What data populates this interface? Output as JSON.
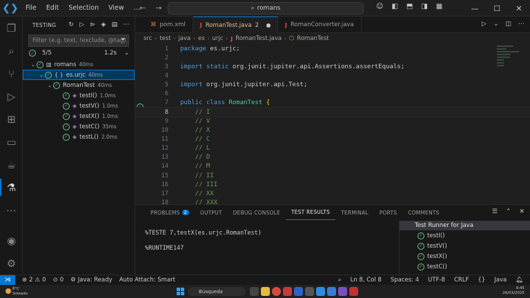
{
  "titlebar": {
    "menu": [
      "File",
      "Edit",
      "Selection",
      "View"
    ],
    "more": "…",
    "search_text": "romans"
  },
  "sidebar": {
    "title": "TESTING",
    "filter_placeholder": "Filter (e.g. text, !exclude, @tag)",
    "summary": "5/5",
    "summary_time": "1.2s",
    "tree": [
      {
        "label": "romans",
        "duration": "40ms",
        "kind": "module",
        "level": 0
      },
      {
        "label": "es.urjc",
        "duration": "40ms",
        "kind": "package",
        "level": 1
      },
      {
        "label": "RomanTest",
        "duration": "40ms",
        "kind": "class",
        "level": 2
      },
      {
        "label": "testI()",
        "duration": "1.0ms",
        "kind": "method",
        "level": 3
      },
      {
        "label": "testV()",
        "duration": "1.0ms",
        "kind": "method",
        "level": 3
      },
      {
        "label": "testX()",
        "duration": "1.0ms",
        "kind": "method",
        "level": 3
      },
      {
        "label": "testC()",
        "duration": "35ms",
        "kind": "method",
        "level": 3
      },
      {
        "label": "testL()",
        "duration": "2.0ms",
        "kind": "method",
        "level": 3
      }
    ]
  },
  "editor": {
    "tabs": [
      {
        "label": "pom.xml",
        "badge": ""
      },
      {
        "label": "RomanTest.java",
        "badge": "2"
      },
      {
        "label": "RomanConverter.java",
        "badge": ""
      }
    ],
    "breadcrumb": [
      "src",
      "test",
      "java",
      "es",
      "urjc",
      "RomanTest.java",
      "RomanTest"
    ],
    "lines": [
      {
        "n": "1",
        "text": "package es.urjc;"
      },
      {
        "n": "2",
        "text": ""
      },
      {
        "n": "3",
        "text": "import static org.junit.jupiter.api.Assertions.assertEquals;"
      },
      {
        "n": "4",
        "text": ""
      },
      {
        "n": "5",
        "text": "import org.junit.jupiter.api.Test;"
      },
      {
        "n": "6",
        "text": ""
      },
      {
        "n": "7",
        "text": "public class RomanTest {"
      },
      {
        "n": "8",
        "text": "    // I"
      },
      {
        "n": "9",
        "text": "    // V"
      },
      {
        "n": "10",
        "text": "    // X"
      },
      {
        "n": "11",
        "text": "    // C"
      },
      {
        "n": "12",
        "text": "    // L"
      },
      {
        "n": "13",
        "text": "    // D"
      },
      {
        "n": "14",
        "text": "    // M"
      },
      {
        "n": "15",
        "text": "    // II"
      },
      {
        "n": "16",
        "text": "    // III"
      },
      {
        "n": "17",
        "text": "    // XX"
      },
      {
        "n": "18",
        "text": "    // XXX"
      }
    ]
  },
  "panel": {
    "tabs": [
      "PROBLEMS",
      "OUTPUT",
      "DEBUG CONSOLE",
      "TEST RESULTS",
      "TERMINAL",
      "PORTS",
      "COMMENTS"
    ],
    "problems_count": "2",
    "output_lines": [
      "%TESTE  7,testX(es.urjc.RomanTest)",
      "%RUNTIME147"
    ],
    "runner_title": "Test Runner for Java",
    "runner_items": [
      "testI()",
      "testV()",
      "testX()",
      "testC()"
    ]
  },
  "statusbar": {
    "errors": "2",
    "warnings": "0",
    "java": "Java: Ready",
    "auto_attach": "Auto Attach: Smart",
    "position": "Ln 8, Col 8",
    "spaces": "Spaces: 4",
    "encoding": "UTF-8",
    "eol": "CRLF",
    "lang": "Java"
  },
  "taskbar": {
    "temp": "8°C",
    "weather": "Soleado",
    "search": "Búsqueda",
    "time": "9:45",
    "date": "26/03/2025"
  },
  "colors": {
    "accent": "#0078d4",
    "pass": "#73c991",
    "modified": "#e2c08d",
    "java": "#f14c4c"
  }
}
